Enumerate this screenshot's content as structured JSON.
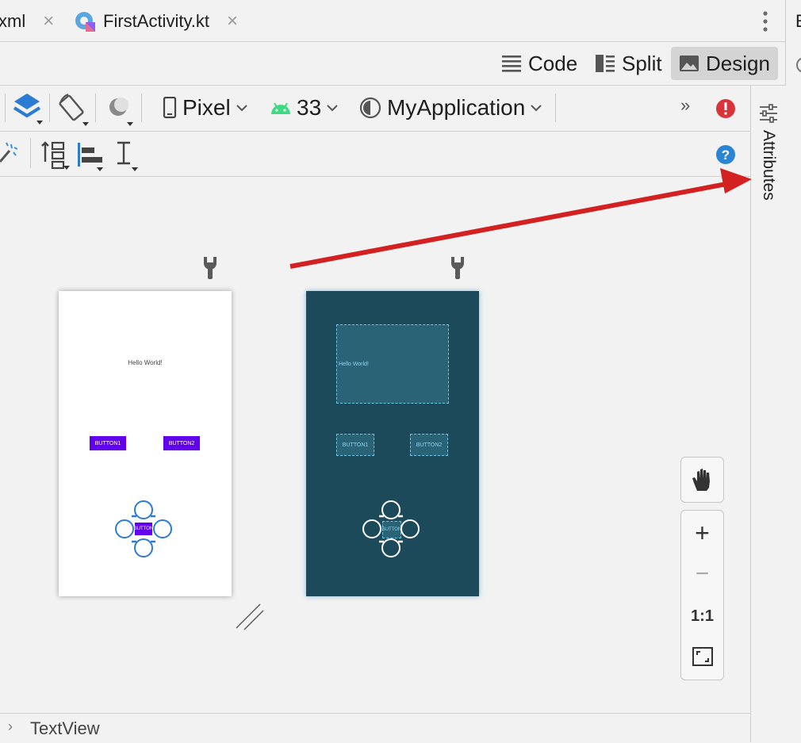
{
  "tabs": [
    {
      "label": "xml"
    },
    {
      "label": "FirstActivity.kt"
    }
  ],
  "far_right_letter": "E",
  "modes": {
    "code": "Code",
    "split": "Split",
    "design": "Design"
  },
  "toolbar": {
    "device": "Pixel",
    "api_level": "33",
    "theme": "MyApplication",
    "overflow": "»"
  },
  "side_panel": {
    "attributes": "Attributes"
  },
  "phone_light": {
    "hello": "Hello World!",
    "button1": "BUTTON1",
    "button2": "BUTTON2",
    "center_button": "BUTTON"
  },
  "phone_dark": {
    "hello": "Hello World!",
    "button1": "BUTTON1",
    "button2": "BUTTON2",
    "center_button": "BUTTON"
  },
  "zoom": {
    "one_to_one": "1:1",
    "plus": "+",
    "minus": "−"
  },
  "status": {
    "component": "TextView"
  },
  "colors": {
    "accent_red": "#d32020",
    "error": "#d9343b",
    "help": "#2a86d4",
    "button": "#6200ee",
    "blueprint_bg": "#1c4a5a"
  }
}
